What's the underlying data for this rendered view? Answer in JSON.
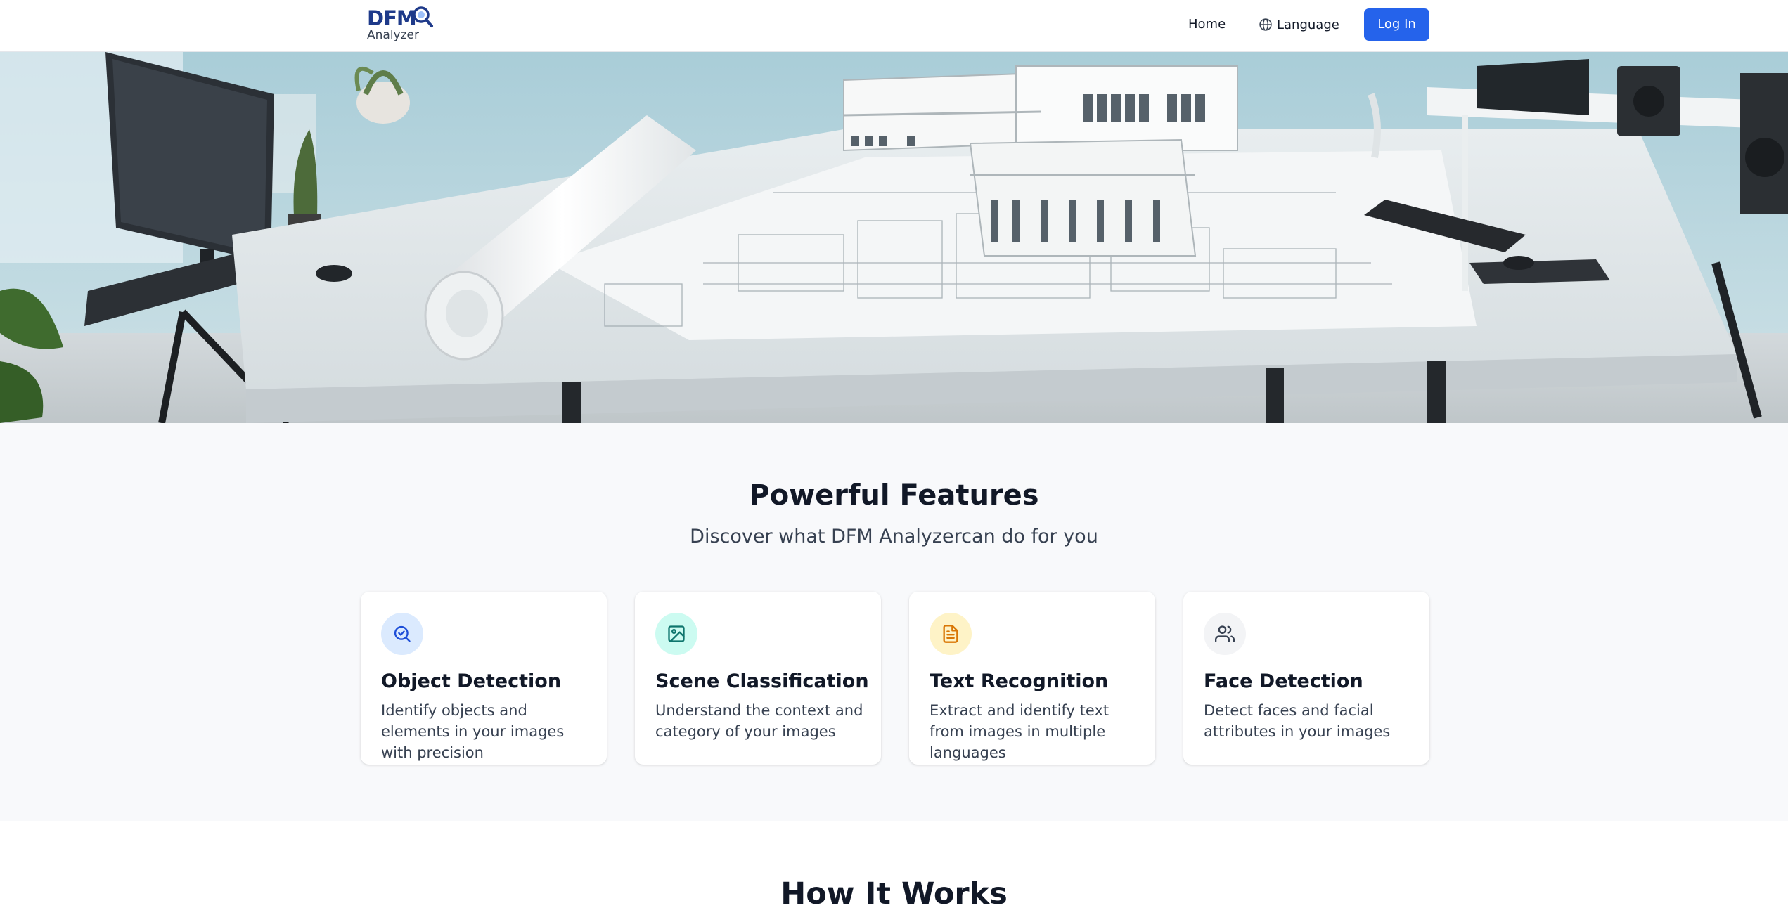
{
  "header": {
    "logo_primary": "DFM",
    "logo_secondary": "Analyzer",
    "nav": {
      "home_label": "Home",
      "language_label": "Language",
      "login_label": "Log In"
    }
  },
  "features": {
    "title": "Powerful Features",
    "subtitle": "Discover what DFM Analyzercan do for you",
    "cards": [
      {
        "title": "Object Detection",
        "description": "Identify objects and elements in your images with precision",
        "icon": "search-check-icon",
        "icon_bg": "#dbeafe",
        "icon_color": "#1d4ed8"
      },
      {
        "title": "Scene Classification",
        "description": "Understand the context and category of your images",
        "icon": "image-icon",
        "icon_bg": "#ccfbf1",
        "icon_color": "#0f766e"
      },
      {
        "title": "Text Recognition",
        "description": "Extract and identify text from images in multiple languages",
        "icon": "document-icon",
        "icon_bg": "#fef3c7",
        "icon_color": "#d97706"
      },
      {
        "title": "Face Detection",
        "description": "Detect faces and facial attributes in your images",
        "icon": "users-icon",
        "icon_bg": "#f3f4f6",
        "icon_color": "#374151"
      }
    ]
  },
  "how_it_works": {
    "title": "How It Works"
  },
  "colors": {
    "primary": "#2563eb",
    "brand_dark": "#1e3a8a",
    "section_bg": "#f8f9fb"
  }
}
